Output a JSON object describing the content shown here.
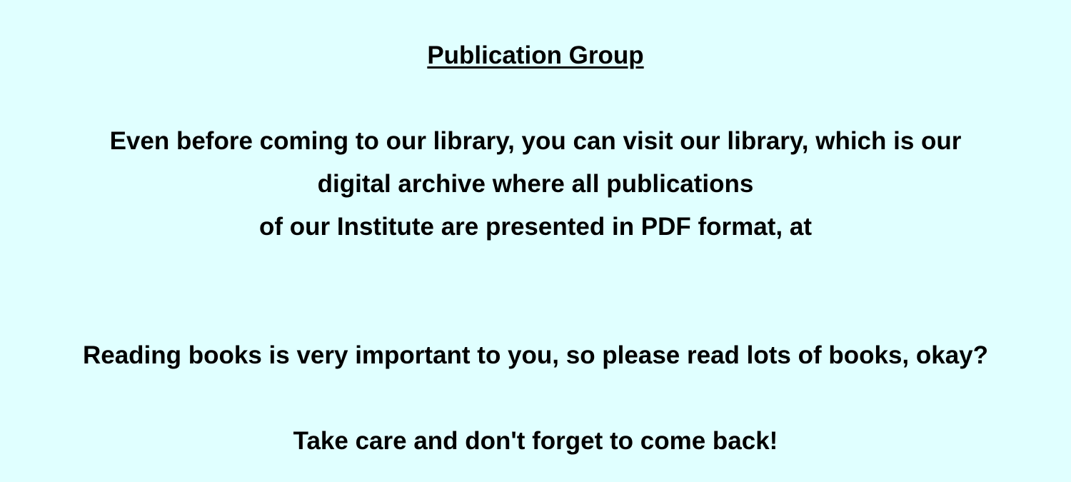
{
  "heading": "Publication Group",
  "intro_lines": [
    "Even before coming to our library, you can visit our library, which is our",
    "digital archive where all publications",
    "of our Institute are presented in PDF format, at"
  ],
  "reading_message": "Reading books is very important to you, so please read lots of books, okay?",
  "farewell_message": "Take care and don't forget to come back!",
  "colors": {
    "background": "#e0ffff",
    "text": "#000000"
  }
}
